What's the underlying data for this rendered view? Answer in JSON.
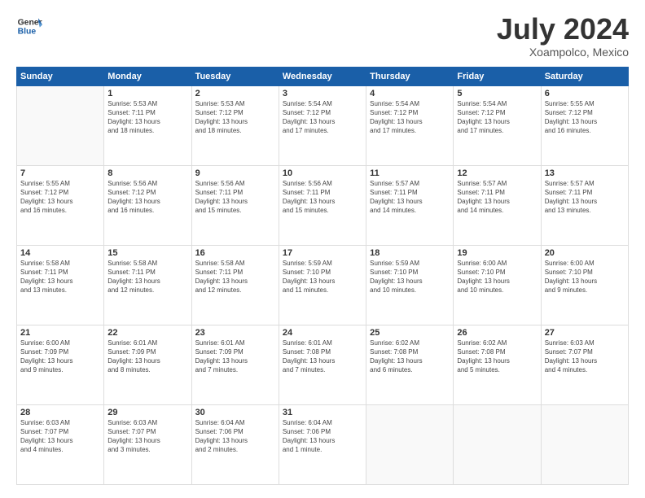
{
  "header": {
    "logo": {
      "general": "General",
      "blue": "Blue"
    },
    "title": "July 2024",
    "location": "Xoampolco, Mexico"
  },
  "weekdays": [
    "Sunday",
    "Monday",
    "Tuesday",
    "Wednesday",
    "Thursday",
    "Friday",
    "Saturday"
  ],
  "weeks": [
    [
      {
        "day": "",
        "info": ""
      },
      {
        "day": "1",
        "info": "Sunrise: 5:53 AM\nSunset: 7:11 PM\nDaylight: 13 hours\nand 18 minutes."
      },
      {
        "day": "2",
        "info": "Sunrise: 5:53 AM\nSunset: 7:12 PM\nDaylight: 13 hours\nand 18 minutes."
      },
      {
        "day": "3",
        "info": "Sunrise: 5:54 AM\nSunset: 7:12 PM\nDaylight: 13 hours\nand 17 minutes."
      },
      {
        "day": "4",
        "info": "Sunrise: 5:54 AM\nSunset: 7:12 PM\nDaylight: 13 hours\nand 17 minutes."
      },
      {
        "day": "5",
        "info": "Sunrise: 5:54 AM\nSunset: 7:12 PM\nDaylight: 13 hours\nand 17 minutes."
      },
      {
        "day": "6",
        "info": "Sunrise: 5:55 AM\nSunset: 7:12 PM\nDaylight: 13 hours\nand 16 minutes."
      }
    ],
    [
      {
        "day": "7",
        "info": "Sunrise: 5:55 AM\nSunset: 7:12 PM\nDaylight: 13 hours\nand 16 minutes."
      },
      {
        "day": "8",
        "info": "Sunrise: 5:56 AM\nSunset: 7:12 PM\nDaylight: 13 hours\nand 16 minutes."
      },
      {
        "day": "9",
        "info": "Sunrise: 5:56 AM\nSunset: 7:11 PM\nDaylight: 13 hours\nand 15 minutes."
      },
      {
        "day": "10",
        "info": "Sunrise: 5:56 AM\nSunset: 7:11 PM\nDaylight: 13 hours\nand 15 minutes."
      },
      {
        "day": "11",
        "info": "Sunrise: 5:57 AM\nSunset: 7:11 PM\nDaylight: 13 hours\nand 14 minutes."
      },
      {
        "day": "12",
        "info": "Sunrise: 5:57 AM\nSunset: 7:11 PM\nDaylight: 13 hours\nand 14 minutes."
      },
      {
        "day": "13",
        "info": "Sunrise: 5:57 AM\nSunset: 7:11 PM\nDaylight: 13 hours\nand 13 minutes."
      }
    ],
    [
      {
        "day": "14",
        "info": "Sunrise: 5:58 AM\nSunset: 7:11 PM\nDaylight: 13 hours\nand 13 minutes."
      },
      {
        "day": "15",
        "info": "Sunrise: 5:58 AM\nSunset: 7:11 PM\nDaylight: 13 hours\nand 12 minutes."
      },
      {
        "day": "16",
        "info": "Sunrise: 5:58 AM\nSunset: 7:11 PM\nDaylight: 13 hours\nand 12 minutes."
      },
      {
        "day": "17",
        "info": "Sunrise: 5:59 AM\nSunset: 7:10 PM\nDaylight: 13 hours\nand 11 minutes."
      },
      {
        "day": "18",
        "info": "Sunrise: 5:59 AM\nSunset: 7:10 PM\nDaylight: 13 hours\nand 10 minutes."
      },
      {
        "day": "19",
        "info": "Sunrise: 6:00 AM\nSunset: 7:10 PM\nDaylight: 13 hours\nand 10 minutes."
      },
      {
        "day": "20",
        "info": "Sunrise: 6:00 AM\nSunset: 7:10 PM\nDaylight: 13 hours\nand 9 minutes."
      }
    ],
    [
      {
        "day": "21",
        "info": "Sunrise: 6:00 AM\nSunset: 7:09 PM\nDaylight: 13 hours\nand 9 minutes."
      },
      {
        "day": "22",
        "info": "Sunrise: 6:01 AM\nSunset: 7:09 PM\nDaylight: 13 hours\nand 8 minutes."
      },
      {
        "day": "23",
        "info": "Sunrise: 6:01 AM\nSunset: 7:09 PM\nDaylight: 13 hours\nand 7 minutes."
      },
      {
        "day": "24",
        "info": "Sunrise: 6:01 AM\nSunset: 7:08 PM\nDaylight: 13 hours\nand 7 minutes."
      },
      {
        "day": "25",
        "info": "Sunrise: 6:02 AM\nSunset: 7:08 PM\nDaylight: 13 hours\nand 6 minutes."
      },
      {
        "day": "26",
        "info": "Sunrise: 6:02 AM\nSunset: 7:08 PM\nDaylight: 13 hours\nand 5 minutes."
      },
      {
        "day": "27",
        "info": "Sunrise: 6:03 AM\nSunset: 7:07 PM\nDaylight: 13 hours\nand 4 minutes."
      }
    ],
    [
      {
        "day": "28",
        "info": "Sunrise: 6:03 AM\nSunset: 7:07 PM\nDaylight: 13 hours\nand 4 minutes."
      },
      {
        "day": "29",
        "info": "Sunrise: 6:03 AM\nSunset: 7:07 PM\nDaylight: 13 hours\nand 3 minutes."
      },
      {
        "day": "30",
        "info": "Sunrise: 6:04 AM\nSunset: 7:06 PM\nDaylight: 13 hours\nand 2 minutes."
      },
      {
        "day": "31",
        "info": "Sunrise: 6:04 AM\nSunset: 7:06 PM\nDaylight: 13 hours\nand 1 minute."
      },
      {
        "day": "",
        "info": ""
      },
      {
        "day": "",
        "info": ""
      },
      {
        "day": "",
        "info": ""
      }
    ]
  ]
}
